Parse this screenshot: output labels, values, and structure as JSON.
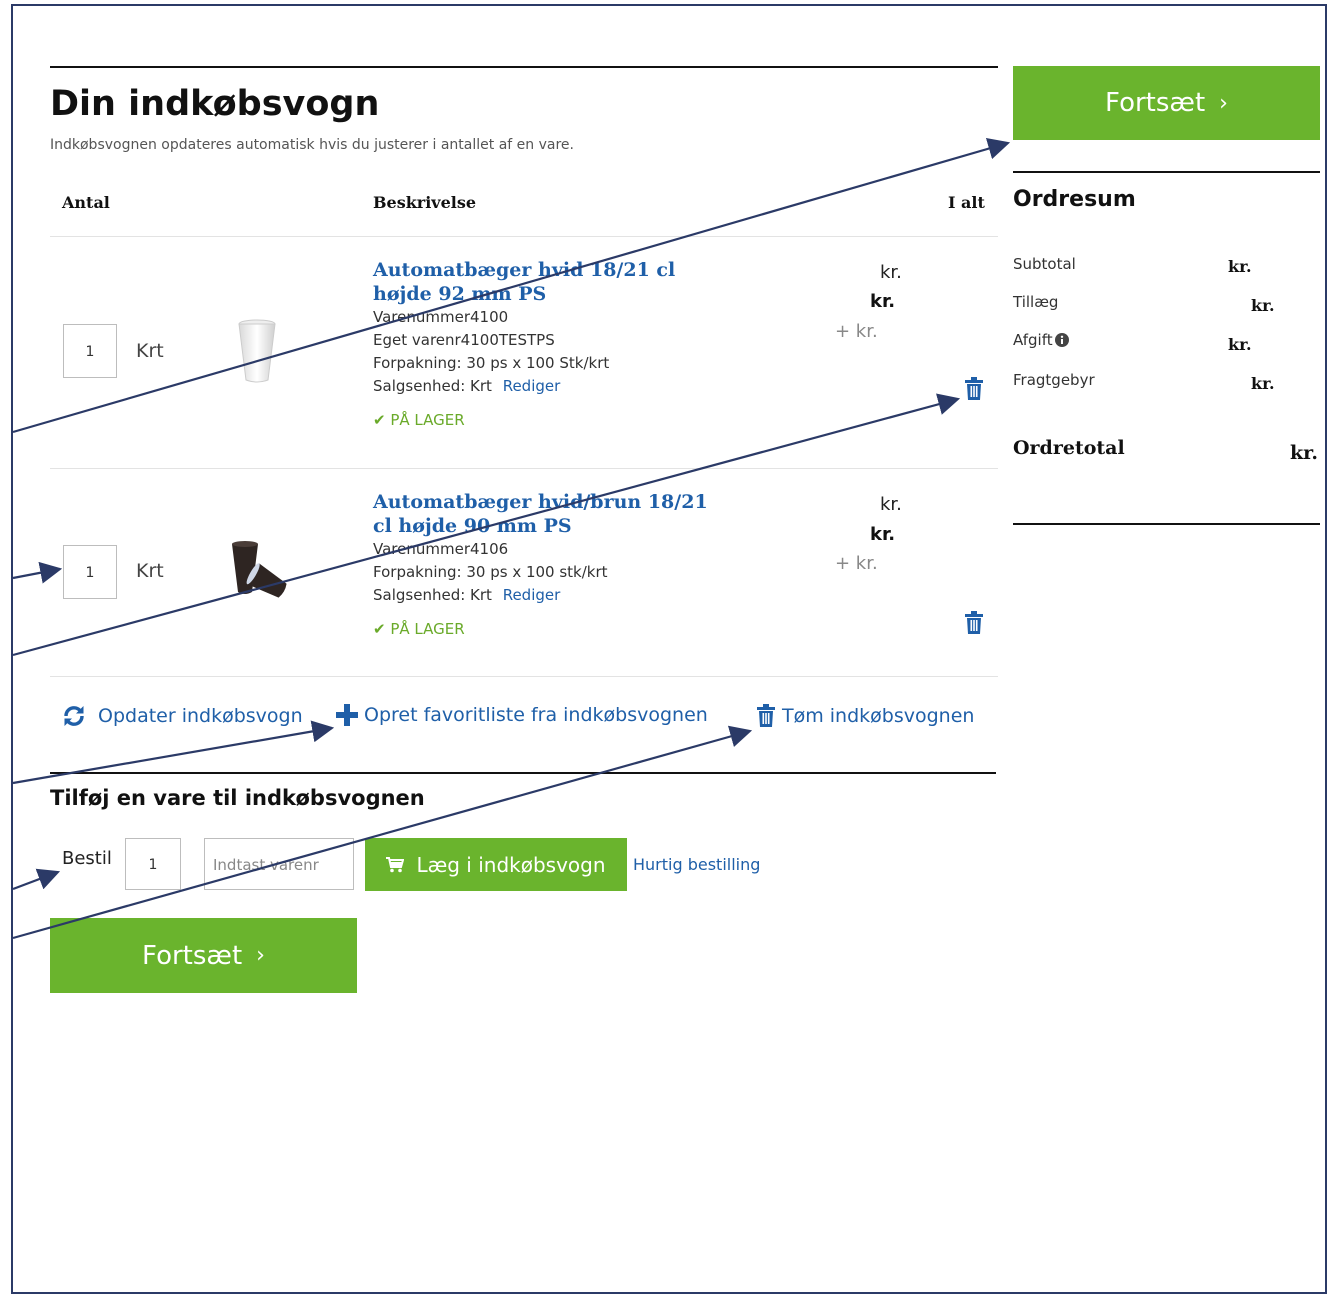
{
  "cart": {
    "title": "Din indkøbsvogn",
    "subtitle": "Indkøbsvognen opdateres automatisk hvis du justerer i antallet af en vare.",
    "columns": {
      "qty": "Antal",
      "description": "Beskrivelse",
      "total": "I alt"
    },
    "items": [
      {
        "qty": "1",
        "unit": "Krt",
        "name": "Automatbæger hvid 18/21 cl højde 92 mm PS",
        "lines": [
          "Varenummer4100",
          "Eget varenr4100TESTPS",
          "Forpakning: 30 ps x 100 Stk/krt"
        ],
        "sales_unit_label": "Salgsenhed: Krt",
        "edit_label": "Rediger",
        "stock": "PÅ LAGER",
        "price": "kr.",
        "price_bold": "kr.",
        "price_extra": "+ kr."
      },
      {
        "qty": "1",
        "unit": "Krt",
        "name": "Automatbæger hvid/brun 18/21 cl højde 90 mm PS",
        "lines": [
          "Varenummer4106",
          "Forpakning: 30 ps x 100 stk/krt"
        ],
        "sales_unit_label": "Salgsenhed: Krt",
        "edit_label": "Rediger",
        "stock": "PÅ LAGER",
        "price": "kr.",
        "price_bold": "kr.",
        "price_extra": "+ kr."
      }
    ],
    "actions": {
      "update": "Opdater indkøbsvogn",
      "favorite": "Opret favoritliste fra indkøbsvognen",
      "empty": "Tøm indkøbsvognen"
    }
  },
  "add_item": {
    "title": "Tilføj en vare til indkøbsvognen",
    "order_label": "Bestil",
    "qty": "1",
    "item_placeholder": "Indtast varenr",
    "add_button": "Læg i indkøbsvogn",
    "quick_order": "Hurtig bestilling"
  },
  "continue_button": "Fortsæt",
  "summary": {
    "title": "Ordresum",
    "rows": [
      {
        "label": "Subtotal",
        "value": "kr."
      },
      {
        "label": "Tillæg",
        "value": "kr."
      },
      {
        "label": "Afgift",
        "value": "kr."
      },
      {
        "label": "Fragtgebyr",
        "value": "kr."
      }
    ],
    "total_label": "Ordretotal",
    "total_value": "kr."
  },
  "colors": {
    "accent_green": "#6ab42d",
    "link_blue": "#1f5fa8",
    "annotation": "#2b3a67"
  },
  "icons": [
    "check-icon",
    "trash-icon",
    "refresh-icon",
    "plus-icon",
    "cart-icon",
    "chevron-right-icon",
    "info-icon"
  ]
}
